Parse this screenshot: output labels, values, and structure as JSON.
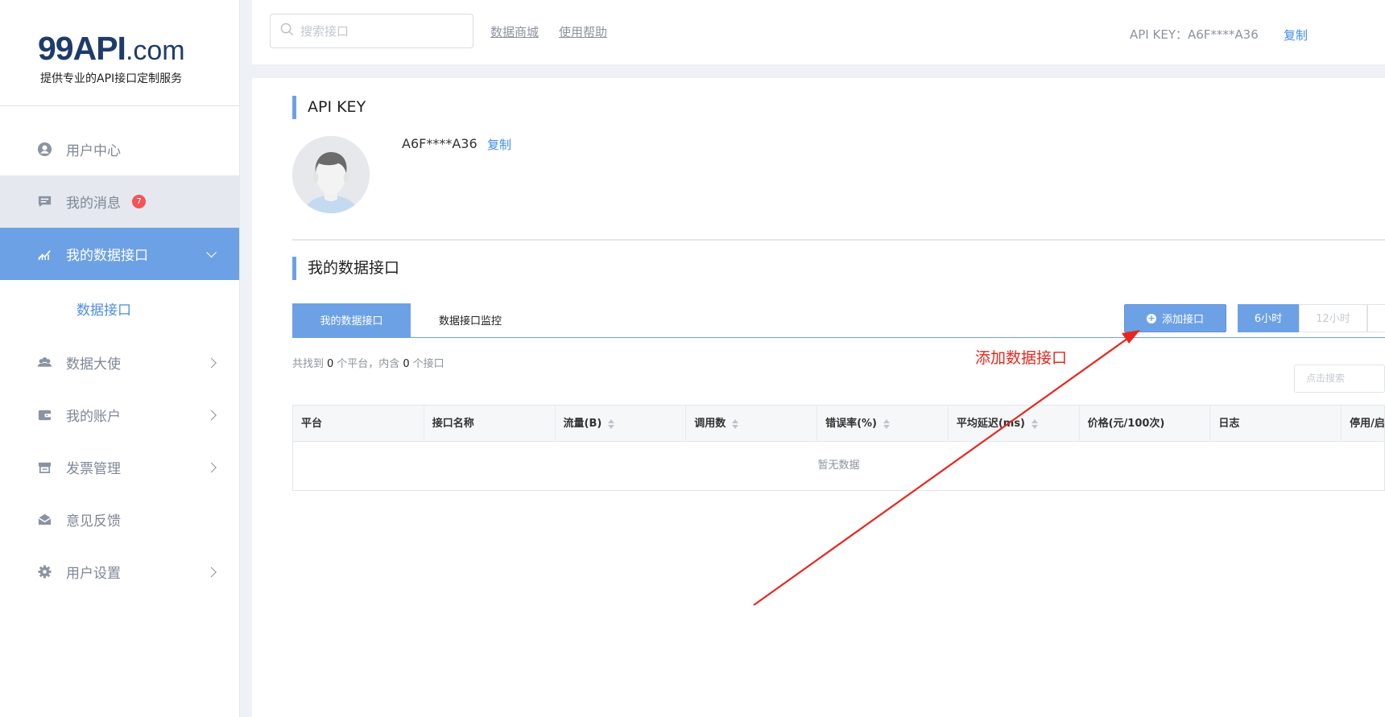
{
  "brand": {
    "logo_main": "99API",
    "logo_suffix": ".com",
    "tagline": "提供专业的API接口定制服务"
  },
  "sidebar": {
    "items": [
      {
        "label": "用户中心",
        "icon": "user-circle-icon"
      },
      {
        "label": "我的消息",
        "icon": "message-icon",
        "badge": "7"
      },
      {
        "label": "我的数据接口",
        "icon": "chart-icon"
      },
      {
        "label": "数据接口"
      },
      {
        "label": "数据大使",
        "icon": "people-icon"
      },
      {
        "label": "我的账户",
        "icon": "wallet-icon"
      },
      {
        "label": "发票管理",
        "icon": "invoice-icon"
      },
      {
        "label": "意见反馈",
        "icon": "inbox-icon"
      },
      {
        "label": "用户设置",
        "icon": "gear-icon"
      }
    ]
  },
  "topbar": {
    "search_placeholder": "搜索接口",
    "links": [
      "数据商城",
      "使用帮助"
    ],
    "api_key_label": "API KEY：A6F****A36",
    "copy_label": "复制"
  },
  "api_key_section": {
    "title": "API KEY",
    "key_value": "A6F****A36",
    "copy_label": "复制"
  },
  "data_api_section": {
    "title": "我的数据接口",
    "tabs": [
      "我的数据接口",
      "数据接口监控"
    ],
    "add_button": "添加接口",
    "time_ranges": [
      "6小时",
      "12小时"
    ],
    "summary": {
      "prefix": "共找到",
      "platform_count": "0",
      "mid": "个平台，内含",
      "api_count": "0",
      "suffix": "个接口"
    },
    "search_placeholder": "点击搜索",
    "columns": [
      "平台",
      "接口名称",
      "流量(B)",
      "调用数",
      "错误率(%)",
      "平均延迟(ms)",
      "价格(元/100次)",
      "日志",
      "停用/启"
    ],
    "empty_text": "暂无数据"
  },
  "annotation": {
    "text": "添加数据接口",
    "color": "#e8261d"
  },
  "colors": {
    "accent": "#6da1e6",
    "link": "#3d8ee8",
    "badge": "#f25458",
    "brand": "#1e3c6b"
  }
}
